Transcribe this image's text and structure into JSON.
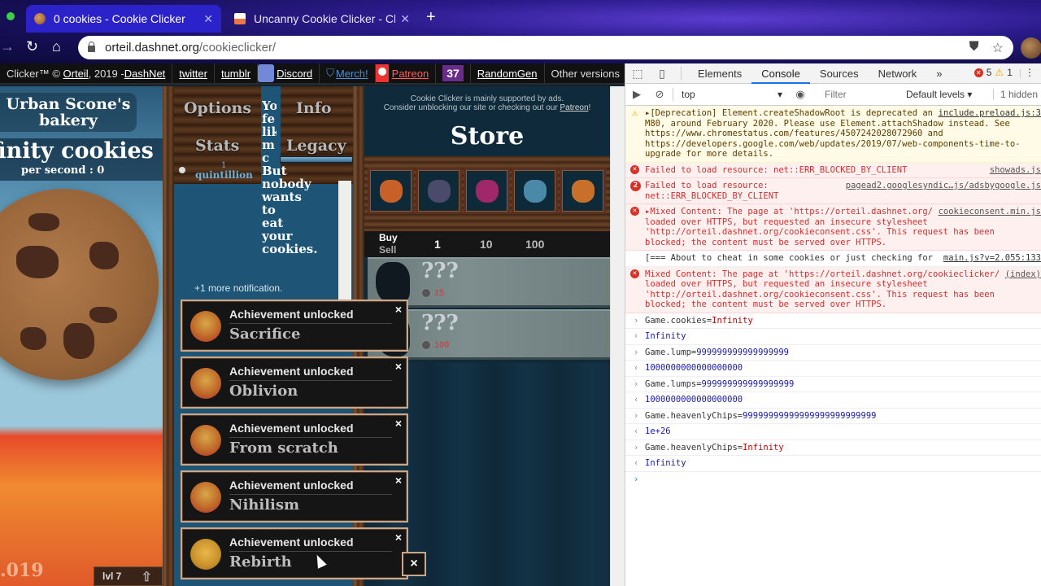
{
  "browser": {
    "tabs": [
      {
        "title": "0 cookies - Cookie Clicker",
        "active": true
      },
      {
        "title": "Uncanny Cookie Clicker - Chro",
        "active": false
      }
    ],
    "new_tab": "+",
    "url_host": "orteil.dashnet.org",
    "url_path": "/cookieclicker/"
  },
  "game": {
    "topbar": {
      "copyright_prefix": "Clicker™ © ",
      "author": "Orteil",
      "year_sep": ", 2019 - ",
      "publisher": "DashNet",
      "links": [
        "twitter",
        "tumblr",
        "Discord",
        "Merch!",
        "Patreon"
      ],
      "heralds": "37",
      "randomgen": "RandomGen",
      "other_versions": "Other versions"
    },
    "bakery_name": "Urban Scone's bakery",
    "cookies_display": "finity cookies",
    "per_second": "per second : 0",
    "version": ".019",
    "level": "lvl 7",
    "menu": {
      "options": "Options",
      "info": "Info",
      "stats": "Stats",
      "legacy": "Legacy"
    },
    "lumps": {
      "count": "1",
      "unit": "quintillion"
    },
    "milk_text_partial": [
      "Yo",
      "fe",
      "lik",
      "m",
      "c"
    ],
    "milk_text_lines": [
      "But",
      "nobody",
      "wants",
      "to",
      "eat",
      "your",
      "cookies."
    ],
    "more_notifications": "+1 more notification.",
    "notifications": [
      {
        "heading": "Achievement unlocked",
        "name": "Sacrifice",
        "icon": "red-cookie-icon"
      },
      {
        "heading": "Achievement unlocked",
        "name": "Oblivion",
        "icon": "red-cookie-icon"
      },
      {
        "heading": "Achievement unlocked",
        "name": "From scratch",
        "icon": "red-cookie-icon"
      },
      {
        "heading": "Achievement unlocked",
        "name": "Nihilism",
        "icon": "red-cookie-icon"
      },
      {
        "heading": "Achievement unlocked",
        "name": "Rebirth",
        "icon": "gold-cookie-icon"
      }
    ],
    "close_symbol": "×",
    "store": {
      "ad_line1": "Cookie Clicker is mainly supported by ads.",
      "ad_line2": "Consider unblocking our site or checking out our ",
      "ad_link": "Patreon",
      "ad_end": "!",
      "title": "Store",
      "upgrades": [
        {
          "name": "cookie-upgrade-icon",
          "color": "#c8602a"
        },
        {
          "name": "kitten-upgrade-icon",
          "color": "#4a4a6a"
        },
        {
          "name": "kitten-upgrade-icon",
          "color": "#a0286a"
        },
        {
          "name": "kitten-upgrade-icon",
          "color": "#4a8aa8"
        },
        {
          "name": "kitten-upgrade-icon",
          "color": "#c8702a"
        }
      ],
      "buy": "Buy",
      "sell": "Sell",
      "amounts": [
        "1",
        "10",
        "100"
      ],
      "selected_amount": "1",
      "products": [
        {
          "name": "???",
          "cost": "15"
        },
        {
          "name": "???",
          "cost": "100"
        }
      ]
    }
  },
  "devtools": {
    "tabs": [
      "Elements",
      "Console",
      "Sources",
      "Network"
    ],
    "active_tab": "Console",
    "more": "»",
    "error_count": "5",
    "warning_count": "1",
    "context": "top",
    "filter_placeholder": "Filter",
    "levels": "Default levels ▾",
    "hidden": "1 hidden",
    "messages": [
      {
        "type": "warn",
        "source": "include.preload.js:3",
        "text": "▸[Deprecation] Element.createShadowRoot is deprecated and will be removed in M80, around February 2020. Please use Element.attachShadow instead. See https://www.chromestatus.com/features/4507242028072960 and https://developers.google.com/web/updates/2019/07/web-components-time-to-upgrade for more details."
      },
      {
        "type": "error",
        "source": "showads.js",
        "text": "Failed to load resource: net::ERR_BLOCKED_BY_CLIENT"
      },
      {
        "type": "error",
        "count": "2",
        "source": "pagead2.googlesyndic…js/adsbygoogle.js",
        "text": "Failed to load resource: net::ERR_BLOCKED_BY_CLIENT"
      },
      {
        "type": "error",
        "source": "cookieconsent.min.js",
        "text": "▸Mixed Content: The page at 'https://orteil.dashnet.org/cookieclicker/' was loaded over HTTPS, but requested an insecure stylesheet 'http://orteil.dashnet.org/cookieconsent.css'. This request has been blocked; the content must be served over HTTPS."
      },
      {
        "type": "log",
        "source": "main.js?v=2.055:133",
        "text": "[=== About to cheat in some cookies or just checking for bugs? ===]"
      },
      {
        "type": "error",
        "source": "(index)",
        "text": "Mixed Content: The page at 'https://orteil.dashnet.org/cookieclicker/' was loaded over HTTPS, but requested an insecure stylesheet 'http://orteil.dashnet.org/cookieconsent.css'. This request has been blocked; the content must be served over HTTPS."
      }
    ],
    "commands": [
      {
        "input_lhs": "Game.cookies=",
        "input_rhs": "Infinity",
        "rhs_kind": "kw",
        "output": "Infinity"
      },
      {
        "input_lhs": "Game.lump=",
        "input_rhs": "999999999999999999",
        "rhs_kind": "num",
        "output": "1000000000000000000"
      },
      {
        "input_lhs": "Game.lumps=",
        "input_rhs": "999999999999999999",
        "rhs_kind": "num",
        "output": "1000000000000000000"
      },
      {
        "input_lhs": "Game.heavenlyChips=",
        "input_rhs": "99999999999999999999999999",
        "rhs_kind": "num",
        "output": "1e+26"
      },
      {
        "input_lhs": "Game.heavenlyChips=",
        "input_rhs": "Infinity",
        "rhs_kind": "kw",
        "output": "Infinity"
      }
    ]
  }
}
